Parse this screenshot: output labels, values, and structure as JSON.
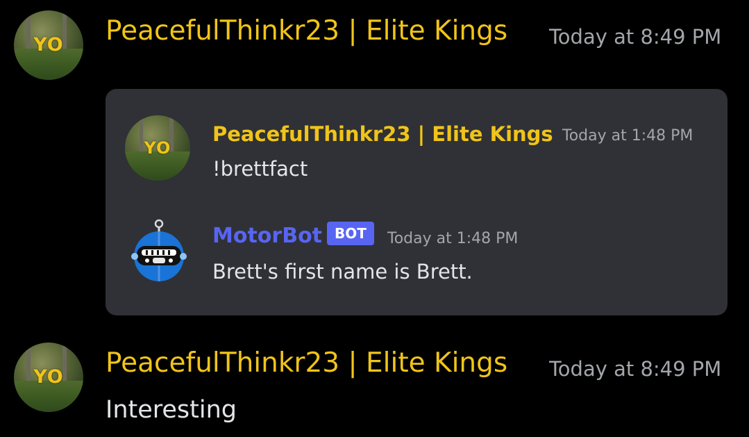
{
  "messages": [
    {
      "author": "PeacefulThinkr23 | Elite Kings",
      "timestamp": "Today at 8:49 PM",
      "avatar_text": "YO"
    },
    {
      "author": "PeacefulThinkr23 | Elite Kings",
      "timestamp": "Today at 8:49 PM",
      "avatar_text": "YO",
      "content": "Interesting"
    }
  ],
  "embedded_screenshot": {
    "first": {
      "author": "PeacefulThinkr23 | Elite Kings",
      "timestamp": "Today at 1:48 PM",
      "avatar_text": "YO",
      "content": "!brettfact"
    },
    "bot": {
      "author": "MotorBot",
      "badge": "BOT",
      "timestamp": "Today at 1:48 PM",
      "content": "Brett's first name is Brett."
    }
  },
  "colors": {
    "background": "#000000",
    "author_gold": "#f0c419",
    "bot_blurple": "#5865f2",
    "embed_bg": "#2f3136",
    "timestamp_gray": "#a3a6ab",
    "text": "#e3e5e8"
  }
}
